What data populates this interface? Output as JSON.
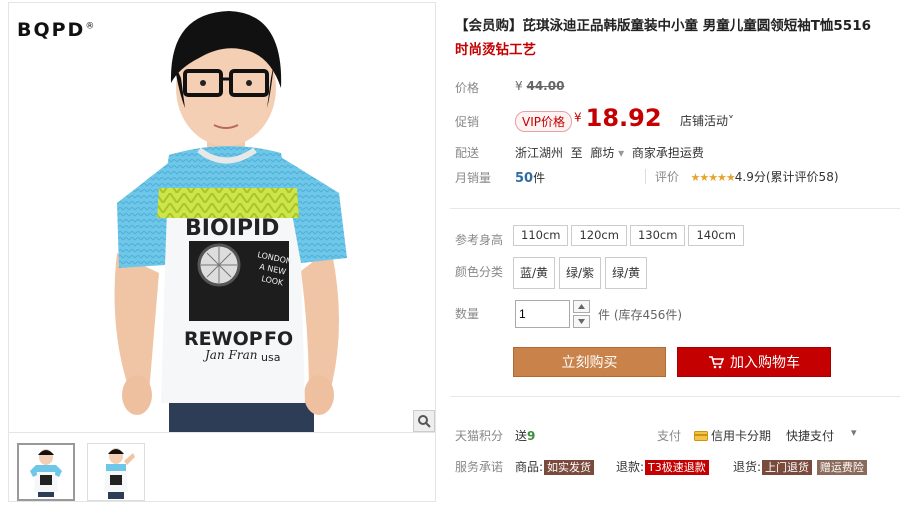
{
  "brand": {
    "logo": "BQPD",
    "reg": "®"
  },
  "product": {
    "title": "【会员购】芘琪泳迪正品韩版童装中小童 男童儿童圆领短袖T恤5516",
    "subtitle": "时尚烫钻工艺",
    "shirt_print": {
      "line1": "BIOIPID",
      "line2": "REWOP",
      "line3": "Jan Fran",
      "side": "LONDON A NEW LOOK",
      "usa": "usa"
    }
  },
  "price": {
    "label": "价格",
    "currency": "¥",
    "original": "44.00",
    "promo_label": "促销",
    "vip_tag": "VIP价格",
    "promo_value": "18.92",
    "store_activity": "店铺活动",
    "store_activity_chev": "˅"
  },
  "shipping": {
    "label": "配送",
    "from": "浙江湖州",
    "to_word": "至",
    "to": "廊坊",
    "chev": "▾",
    "fee_text": "商家承担运费"
  },
  "stats": {
    "sales_label": "月销量",
    "sales_value": "50",
    "sales_unit": "件",
    "rating_label": "评价",
    "stars": "★★★★★",
    "score": "4.9分",
    "reviews": "(累计评价58)"
  },
  "options": {
    "size_label": "参考身高",
    "sizes": [
      "110cm",
      "120cm",
      "130cm",
      "140cm"
    ],
    "color_label": "颜色分类",
    "colors": [
      "蓝/黄",
      "绿/紫",
      "绿/黄"
    ]
  },
  "quantity": {
    "label": "数量",
    "value": "1",
    "unit": "件",
    "stock": "(库存456件)"
  },
  "actions": {
    "buy_now": "立刻购买",
    "add_cart": "加入购物车"
  },
  "points": {
    "label": "天猫积分",
    "prefix": "送",
    "value": "9"
  },
  "payment": {
    "label": "支付",
    "credit": "信用卡分期",
    "quick": "快捷支付",
    "chev": "▾"
  },
  "service": {
    "label": "服务承诺",
    "goods": "商品:",
    "goods_tag": "如实发货",
    "refund": "退款:",
    "refund_tag": "T3极速退款",
    "return": "退货:",
    "return_tag": "上门退货",
    "return_tag2": "赠运费险"
  }
}
